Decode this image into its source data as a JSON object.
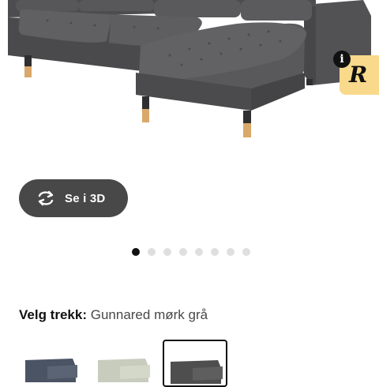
{
  "viewer": {
    "view_3d_label": "Se i 3D",
    "icons": {
      "view_3d": "rotate-arrows-icon",
      "badge": "info-icon"
    },
    "gallery": {
      "count": 8,
      "active_index": 0
    }
  },
  "cover": {
    "label": "Velg trekk:",
    "selected_value": "Gunnared mørk grå"
  },
  "swatches": [
    {
      "color": "#4a5464"
    },
    {
      "color": "#c8ccbd"
    },
    {
      "color": "#4e4e4e",
      "selected": true
    }
  ],
  "colors": {
    "button_bg": "#484848",
    "badge_bg": "#f9d98b",
    "dot_active": "#111111",
    "dot_inactive": "#dfdfdf"
  }
}
